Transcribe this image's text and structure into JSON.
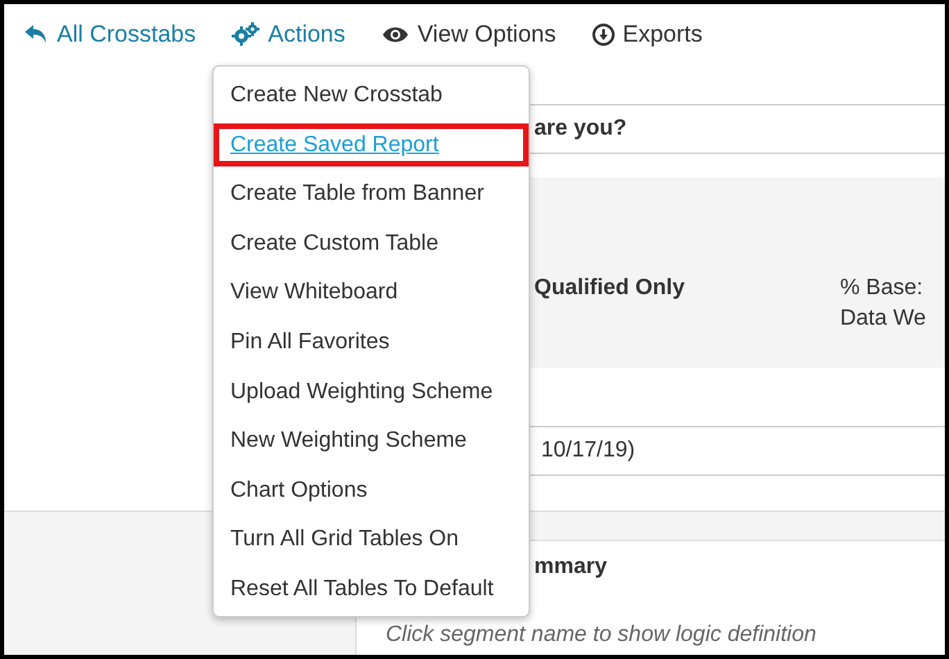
{
  "toolbar": {
    "items": [
      {
        "kind": "back",
        "label": "All Crosstabs",
        "active": true
      },
      {
        "kind": "actions",
        "label": "Actions",
        "active": true
      },
      {
        "kind": "view",
        "label": "View Options",
        "active": false
      },
      {
        "kind": "export",
        "label": "Exports",
        "active": false
      }
    ]
  },
  "menu": {
    "items": [
      {
        "label": "Create New Crosstab",
        "selected": false
      },
      {
        "label": "Create Saved Report",
        "selected": true
      },
      {
        "label": "Create Table from Banner",
        "selected": false
      },
      {
        "label": "Create Custom Table",
        "selected": false
      },
      {
        "label": "View Whiteboard",
        "selected": false
      },
      {
        "label": "Pin All Favorites",
        "selected": false
      },
      {
        "label": "Upload Weighting Scheme",
        "selected": false
      },
      {
        "label": "New Weighting Scheme",
        "selected": false
      },
      {
        "label": "Chart Options",
        "selected": false
      },
      {
        "label": "Turn All Grid Tables On",
        "selected": false
      },
      {
        "label": "Reset All Tables To Default",
        "selected": false
      }
    ]
  },
  "content": {
    "question": "are you?",
    "filter": "Qualified Only",
    "base_labels": [
      "% Base:",
      "Data We"
    ],
    "date_range": "10/17/19)",
    "summary_title": "mmary",
    "summary_hint": "Click segment name to show logic definition"
  }
}
